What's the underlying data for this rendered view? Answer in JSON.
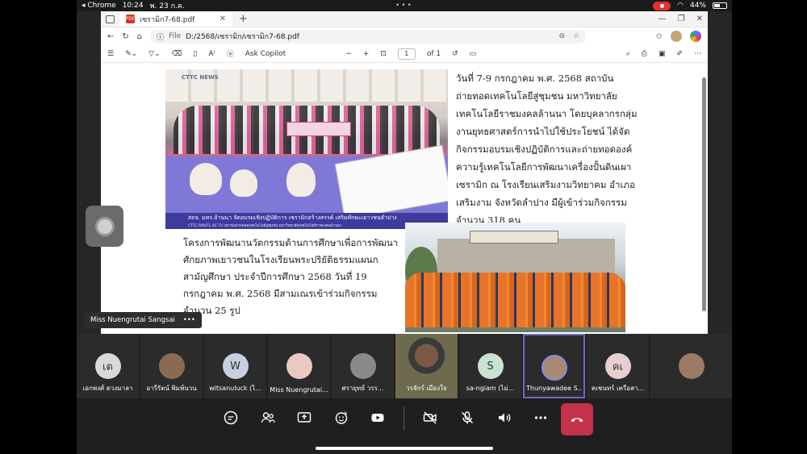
{
  "status_bar": {
    "back_app": "◂ Chrome",
    "time": "10:24",
    "date": "พ. 23 ก.ค.",
    "battery": "44%"
  },
  "browser": {
    "tab_title": "เซรามิก7-68.pdf",
    "address_prefix": "File",
    "url": "D:/2568/เซรามิก/เซรามิก7-68.pdf",
    "ask_copilot": "Ask Copilot",
    "page_number": "1",
    "page_total": "of 1"
  },
  "pdf": {
    "photo1_logo": "CTTC\nNEWS",
    "photo1_caption": "สถจ. มทร.ล้านนา จัดอบรมเชิงปฏิบัติการ เซรามิกสร้างสรรค์ เสริมทักษะเยาวชนลำปาง",
    "photo1_caption_small": "CTTC.RMUTL.AC.TH      สถาบันถ่ายทอดเทคโนโลยีสู่ชุมชน มหาวิทยาลัยเทคโนโลยีราชมงคลล้านนา",
    "paragraph1": "วันที่ 7-9 กรกฎาคม พ.ศ. 2568 สถาบันถ่ายทอดเทคโนโลยีสู่ชุมชน มหาวิทยาลัยเทคโนโลยีราชมงคลล้านนา โดยบุคลากรกลุ่มงานยุทธศาสตร์การนำไปใช้ประโยชน์ ได้จัดกิจกรรมอบรมเชิงปฏิบัติการและถ่ายทอดองค์ความรู้เทคโนโลยีการพัฒนาเครื่องปั้นดินเผาเซรามิก ณ โรงเรียนเสริมงามวิทยาคม อำเภอเสริมงาม จังหวัดลำปาง มีผู้เข้าร่วมกิจกรรม จำนวน 318 คน",
    "paragraph2": "โครงการพัฒนานวัตกรรมด้านการศึกษาเพื่อการพัฒนาศักยภาพเยาวชนในโรงเรียนพระปริยัติธรรมแผนกสามัญศึกษา ประจำปีการศึกษา 2568 วันที่ 19 กรกฎาคม พ.ศ. 2568 มีสามเณรเข้าร่วมกิจกรรม จำนวน 25 รูป"
  },
  "presenter_label": "Miss Nuengrutai  Sangsai",
  "participants": [
    {
      "initials": "เด",
      "name": "เอกพงศ์ ดวงมาลา",
      "avatar_color": "#d9d9d9"
    },
    {
      "initials": "",
      "name": "อารีรัตน์ พิมพ์นวน",
      "avatar_color": "#8a6a50"
    },
    {
      "initials": "W",
      "name": "witsanuluck (ไ...",
      "avatar_color": "#c7cfe0"
    },
    {
      "initials": "",
      "name": "Miss Nuengrutai...",
      "avatar_color": "#e9c9c0"
    },
    {
      "initials": "",
      "name": "ศรายุทธ์   วรร...",
      "avatar_color": "#8a8a8a"
    },
    {
      "initials": "",
      "name": "วรจักร์ เมืองใจ",
      "avatar_color": "#6e6a4e"
    },
    {
      "initials": "S",
      "name": "sa-ngiam (ไม่...",
      "avatar_color": "#c9e2d2"
    },
    {
      "initials": "",
      "name": "Thunyawadee S...",
      "avatar_color": "#a88a72"
    },
    {
      "initials": "คเ",
      "name": "คเชนทร์ เครือสา...",
      "avatar_color": "#e8cfcf"
    },
    {
      "initials": "",
      "name": "",
      "avatar_color": "#9c7a66"
    }
  ]
}
